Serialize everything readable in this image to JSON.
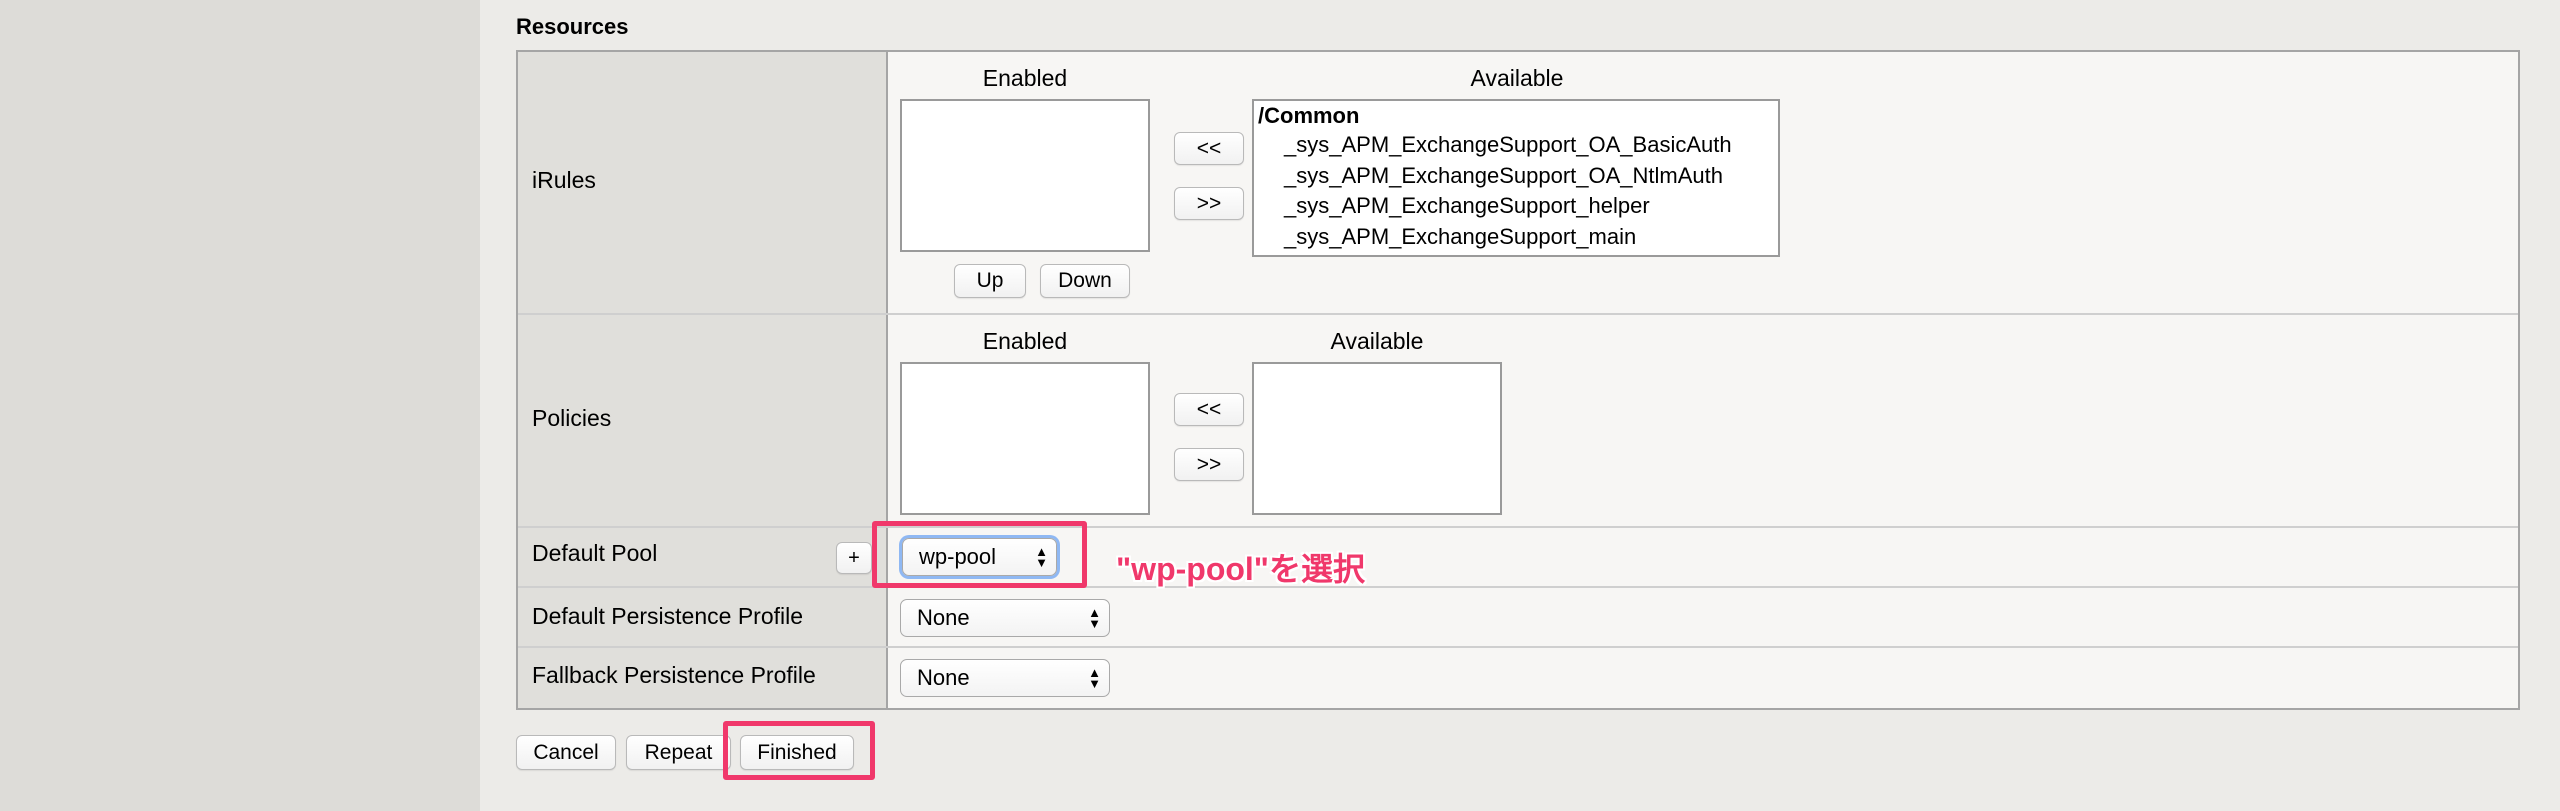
{
  "section_title": "Resources",
  "irules": {
    "label": "iRules",
    "enabled_heading": "Enabled",
    "available_heading": "Available",
    "move_left_label": "<<",
    "move_right_label": ">>",
    "up_label": "Up",
    "down_label": "Down",
    "available_group": "/Common",
    "available_items": [
      "_sys_APM_ExchangeSupport_OA_BasicAuth",
      "_sys_APM_ExchangeSupport_OA_NtlmAuth",
      "_sys_APM_ExchangeSupport_helper",
      "_sys_APM_ExchangeSupport_main"
    ]
  },
  "policies": {
    "label": "Policies",
    "enabled_heading": "Enabled",
    "available_heading": "Available",
    "move_left_label": "<<",
    "move_right_label": ">>"
  },
  "default_pool": {
    "label": "Default Pool",
    "add_label": "+",
    "selected": "wp-pool"
  },
  "default_persistence": {
    "label": "Default Persistence Profile",
    "selected": "None"
  },
  "fallback_persistence": {
    "label": "Fallback Persistence Profile",
    "selected": "None"
  },
  "annotation_text": "\"wp-pool\"を選択",
  "actions": {
    "cancel_label": "Cancel",
    "repeat_label": "Repeat",
    "finished_label": "Finished"
  },
  "colors": {
    "highlight": "#f0386b",
    "label_cell_bg": "#e0dfdb",
    "page_bg": "#ecebe8"
  }
}
